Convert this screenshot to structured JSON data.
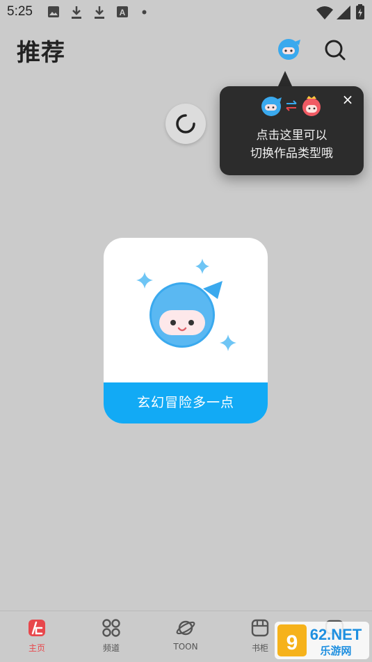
{
  "status_bar": {
    "time": "5:25",
    "icons": [
      "image-icon",
      "download-icon",
      "download-icon",
      "a-icon",
      "dot-icon",
      "wifi-icon",
      "signal-icon",
      "battery-icon"
    ]
  },
  "header": {
    "title": "推荐",
    "mode_toggle_icon": "ninja-avatar-icon",
    "search_icon": "search-icon"
  },
  "tooltip": {
    "line1": "点击这里可以",
    "line2": "切换作品类型哦",
    "close": "×"
  },
  "empty_state": {
    "banner_text": "玄幻冒险多一点"
  },
  "bottom_nav": {
    "items": [
      {
        "label": "主页",
        "icon": "home-icon",
        "active": true
      },
      {
        "label": "频道",
        "icon": "channels-icon",
        "active": false
      },
      {
        "label": "TOON",
        "icon": "planet-icon",
        "active": false
      },
      {
        "label": "书柜",
        "icon": "bookshelf-icon",
        "active": false
      },
      {
        "label": "",
        "icon": "message-icon",
        "active": false
      }
    ]
  },
  "watermark": {
    "brand": "962.NET",
    "sub": "乐游网"
  },
  "colors": {
    "background": "#cbcbcb",
    "accent_blue": "#12aaf5",
    "accent_red": "#e8474c",
    "tooltip_bg": "#2c2c2c"
  }
}
